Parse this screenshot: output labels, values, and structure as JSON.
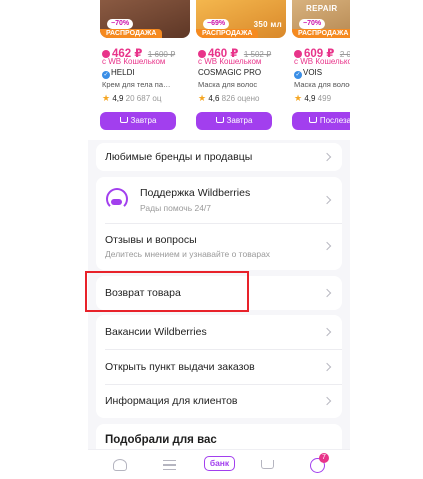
{
  "products": [
    {
      "discount": "−70%",
      "sale": "РАСПРОДАЖА",
      "watermark": "",
      "price": "462 ₽",
      "old_price": "1 600 ₽",
      "wallet": "с WB Кошельком",
      "brand": "HELDI",
      "verified": true,
      "name": "Крем для тела па…",
      "rating": "4,9",
      "reviews": "20 687 оц",
      "button": "Завтра",
      "img_color": "#7a4a35"
    },
    {
      "discount": "−69%",
      "sale": "РАСПРОДАЖА",
      "watermark": "350 мл",
      "price": "460 ₽",
      "old_price": "1 502 ₽",
      "wallet": "с WB Кошельком",
      "brand": "COSMAGIC PRO",
      "verified": false,
      "name": "Маска для волос",
      "rating": "4,6",
      "reviews": "826 оцено",
      "button": "Завтра",
      "img_color": "#e9a23b"
    },
    {
      "discount": "−70%",
      "sale": "РАСПРОДАЖА",
      "watermark": "REPAIR",
      "price": "609 ₽",
      "old_price": "2 0",
      "wallet": "с WB Кошельком",
      "brand": "VOIS",
      "verified": true,
      "name": "Маска для волос",
      "rating": "4,9",
      "reviews": "499",
      "button": "Послеза",
      "img_color": "#c9a06a"
    }
  ],
  "menu": {
    "brands": "Любимые бренды и продавцы",
    "support_title": "Поддержка Wildberries",
    "support_sub": "Рады помочь 24/7",
    "reviews_title": "Отзывы и вопросы",
    "reviews_sub": "Делитесь мнением и узнавайте о товарах",
    "returns": "Возврат товара",
    "vacancies": "Вакансии Wildberries",
    "pickup": "Открыть пункт выдачи заказов",
    "clients": "Информация для клиентов"
  },
  "picked_title": "Подобрали для вас",
  "nav": {
    "bank": "банк",
    "profile_badge": "7"
  },
  "colors": {
    "accent": "#a23fee",
    "price": "#e8348a",
    "highlight": "#e8222a"
  }
}
